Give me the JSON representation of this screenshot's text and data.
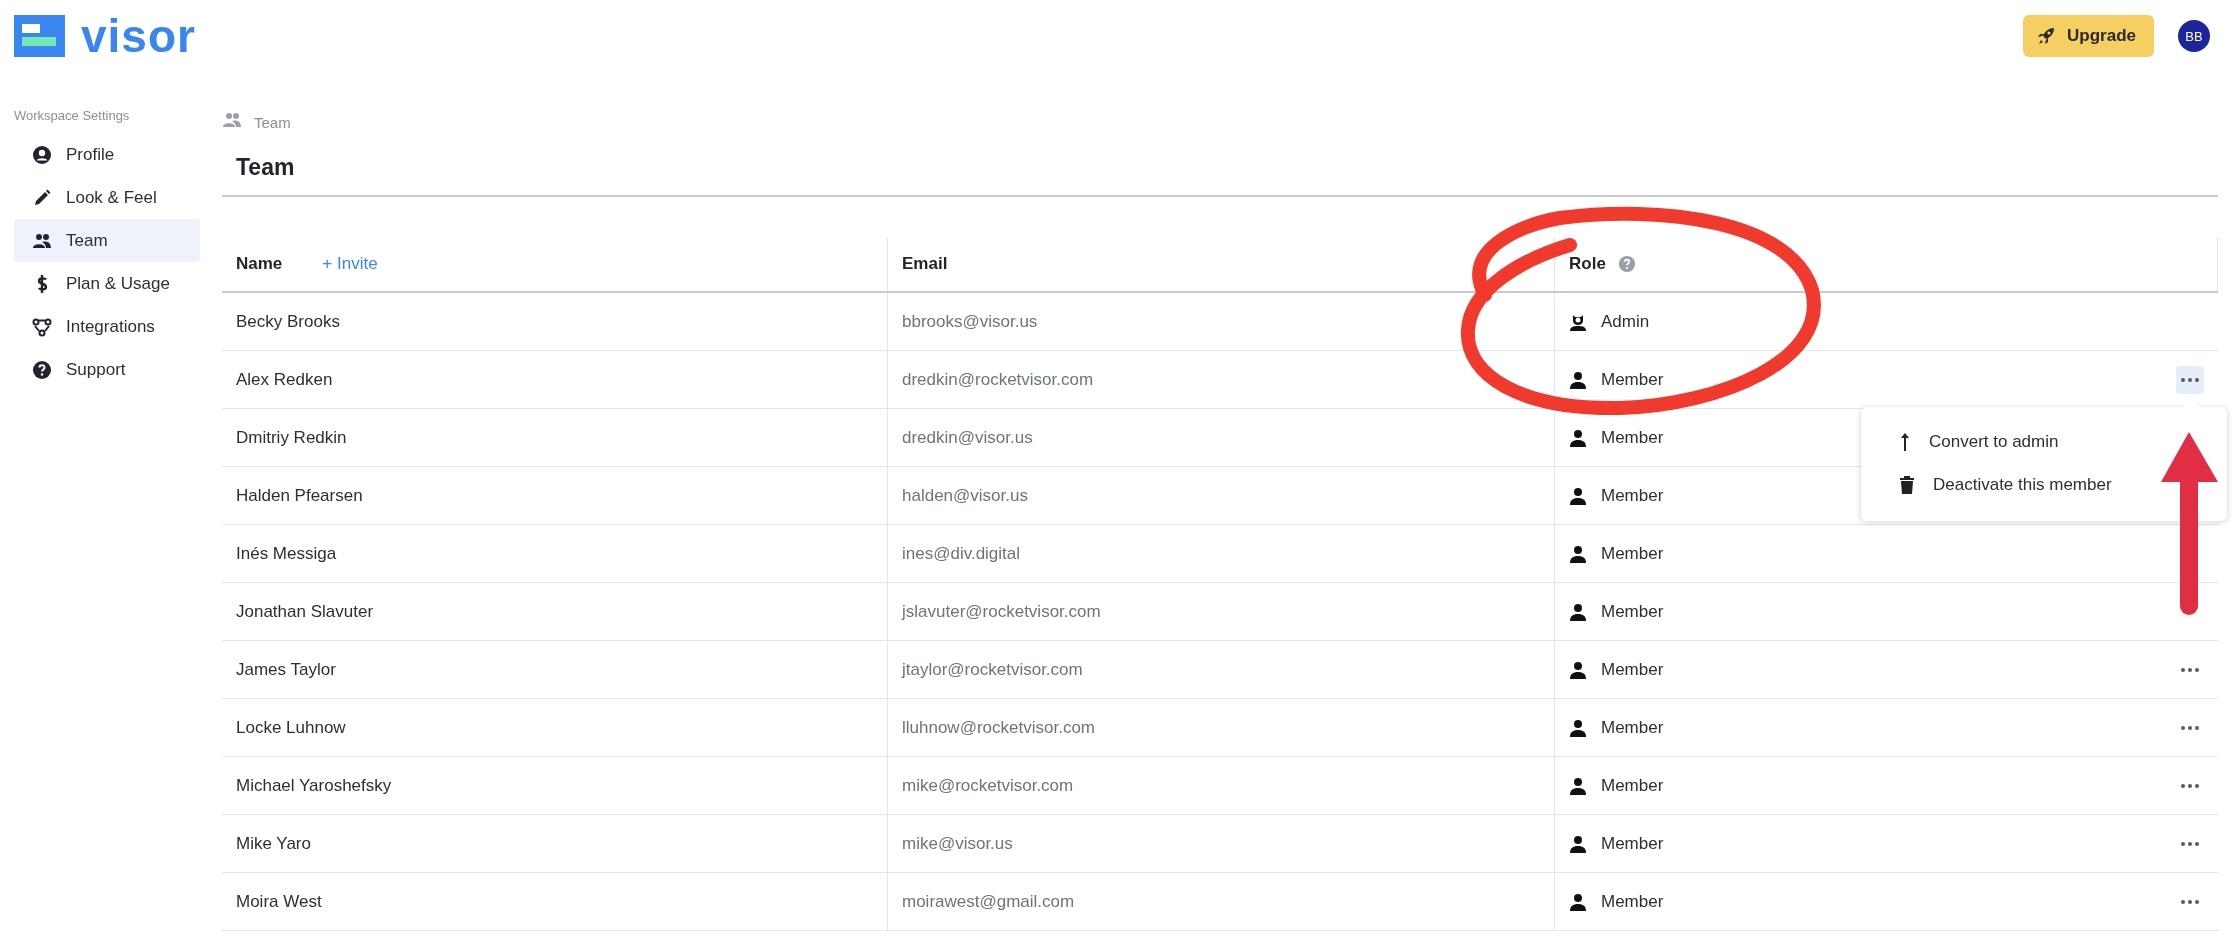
{
  "header": {
    "logo_text": "visor",
    "upgrade_button": "Upgrade",
    "avatar": "BB"
  },
  "sidebar": {
    "heading": "Workspace Settings",
    "items": [
      {
        "label": "Profile",
        "kind": "profile",
        "selected": false
      },
      {
        "label": "Look & Feel",
        "kind": "pencil",
        "selected": false
      },
      {
        "label": "Team",
        "kind": "team",
        "selected": true
      },
      {
        "label": "Plan & Usage",
        "kind": "dollar",
        "selected": false
      },
      {
        "label": "Integrations",
        "kind": "integrations",
        "selected": false
      },
      {
        "label": "Support",
        "kind": "support",
        "selected": false
      }
    ]
  },
  "breadcrumb": "Team",
  "title": "Team",
  "table": {
    "columns": [
      {
        "label": "Name",
        "action": "+ Invite"
      },
      {
        "label": "Email"
      },
      {
        "label": "Role",
        "help_icon": true
      }
    ],
    "rows": [
      {
        "name": "Becky Brooks",
        "email": "bbrooks@visor.us",
        "role": {
          "label": "Admin",
          "kind": "admin"
        },
        "more_button": false,
        "selected": false
      },
      {
        "name": "Alex Redken",
        "email": "dredkin@rocketvisor.com",
        "role": {
          "label": "Member",
          "kind": "member"
        },
        "more_button": true,
        "selected": true
      },
      {
        "name": "Dmitriy Redkin",
        "email": "dredkin@visor.us",
        "role": {
          "label": "Member",
          "kind": "member"
        },
        "more_button": false,
        "selected": false
      },
      {
        "name": "Halden Pfearsen",
        "email": "halden@visor.us",
        "role": {
          "label": "Member",
          "kind": "member"
        },
        "more_button": false,
        "selected": false
      },
      {
        "name": "Inés Messiga",
        "email": "ines@div.digital",
        "role": {
          "label": "Member",
          "kind": "member"
        },
        "more_button": false,
        "selected": false
      },
      {
        "name": "Jonathan Slavuter",
        "email": "jslavuter@rocketvisor.com",
        "role": {
          "label": "Member",
          "kind": "member"
        },
        "more_button": false,
        "selected": false
      },
      {
        "name": "James Taylor",
        "email": "jtaylor@rocketvisor.com",
        "role": {
          "label": "Member",
          "kind": "member"
        },
        "more_button": true,
        "selected": false
      },
      {
        "name": "Locke Luhnow",
        "email": "lluhnow@rocketvisor.com",
        "role": {
          "label": "Member",
          "kind": "member"
        },
        "more_button": true,
        "selected": false
      },
      {
        "name": "Michael Yaroshefsky",
        "email": "mike@rocketvisor.com",
        "role": {
          "label": "Member",
          "kind": "member"
        },
        "more_button": true,
        "selected": false
      },
      {
        "name": "Mike Yaro",
        "email": "mike@visor.us",
        "role": {
          "label": "Member",
          "kind": "member"
        },
        "more_button": true,
        "selected": false
      },
      {
        "name": "Moira West",
        "email": "moirawest@gmail.com",
        "role": {
          "label": "Member",
          "kind": "member"
        },
        "more_button": true,
        "selected": false
      }
    ]
  },
  "row_menu": [
    {
      "label": "Convert to admin",
      "kind": "up"
    },
    {
      "label": "Deactivate this member",
      "kind": "trash"
    }
  ]
}
